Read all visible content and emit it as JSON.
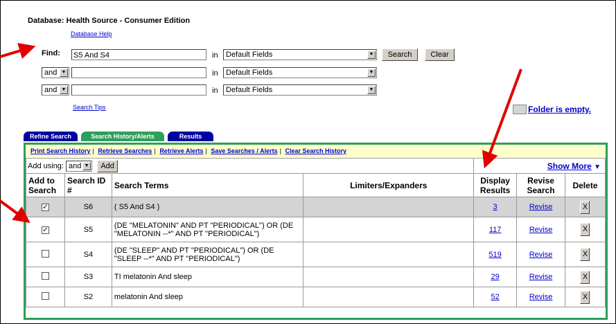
{
  "database": {
    "title": "Database: Health Source - Consumer Edition",
    "help": "Database Help"
  },
  "search": {
    "find_label": "Find:",
    "rows": [
      {
        "bool": "",
        "value": "S5 And S4",
        "in": "in",
        "field": "Default Fields"
      },
      {
        "bool": "and",
        "value": "",
        "in": "in",
        "field": "Default Fields"
      },
      {
        "bool": "and",
        "value": "",
        "in": "in",
        "field": "Default Fields"
      }
    ],
    "search_button": "Search",
    "clear_button": "Clear",
    "tips": "Search Tips"
  },
  "folder": {
    "text": "Folder is empty."
  },
  "tabs": [
    {
      "label": "Refine Search",
      "color": "#0000a0"
    },
    {
      "label": "Search History/Alerts",
      "color": "#2e9e5a"
    },
    {
      "label": "Results",
      "color": "#0000a0"
    }
  ],
  "history_links": [
    "Print Search History",
    "Retrieve Searches",
    "Retrieve Alerts",
    "Save Searches / Alerts",
    "Clear Search History"
  ],
  "add_using": {
    "label": "Add using:",
    "value": "and",
    "button": "Add"
  },
  "show_more": "Show More",
  "columns": {
    "add": "Add to Search",
    "id": "Search ID #",
    "terms": "Search Terms",
    "limiters": "Limiters/Expanders",
    "display": "Display Results",
    "revise": "Revise Search",
    "delete": "Delete"
  },
  "rows": [
    {
      "checked": true,
      "id": "S6",
      "terms": "( S5 And S4 )",
      "results": "3",
      "revise": "Revise",
      "delete": "X",
      "highlight": true
    },
    {
      "checked": true,
      "id": "S5",
      "terms": "(DE \"MELATONIN\" AND PT \"PERIODICAL\") OR (DE \"MELATONIN --*\" AND PT \"PERIODICAL\")",
      "results": "117",
      "revise": "Revise",
      "delete": "X",
      "highlight": false
    },
    {
      "checked": false,
      "id": "S4",
      "terms": "(DE \"SLEEP\" AND PT \"PERIODICAL\") OR (DE \"SLEEP --*\" AND PT \"PERIODICAL\")",
      "results": "519",
      "revise": "Revise",
      "delete": "X",
      "highlight": false
    },
    {
      "checked": false,
      "id": "S3",
      "terms": "TI melatonin And sleep",
      "results": "29",
      "revise": "Revise",
      "delete": "X",
      "highlight": false
    },
    {
      "checked": false,
      "id": "S2",
      "terms": "melatonin And sleep",
      "results": "52",
      "revise": "Revise",
      "delete": "X",
      "highlight": false
    }
  ],
  "colors": {
    "accent_green": "#2e9e5a",
    "tab_blue": "#0000a0",
    "annotation_red": "#e00000",
    "link": "#0000cc"
  }
}
